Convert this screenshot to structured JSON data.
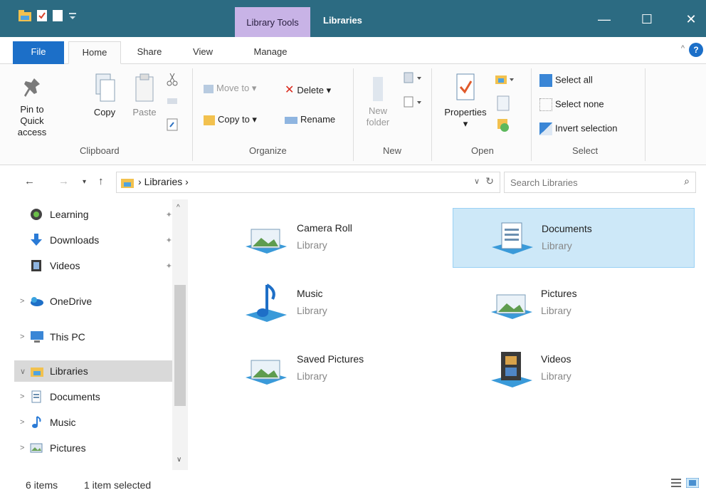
{
  "titlebar": {
    "context_tab": "Library Tools",
    "title": "Libraries",
    "minimize": "—",
    "maximize": "☐",
    "close": "✕",
    "bg_color": "#2c6b82"
  },
  "tabs": {
    "file": "File",
    "home": "Home",
    "share": "Share",
    "view": "View",
    "manage": "Manage",
    "help": "?"
  },
  "ribbon": {
    "clipboard": {
      "pin": "Pin to Quick access",
      "copy": "Copy",
      "paste": "Paste",
      "label": "Clipboard"
    },
    "organize": {
      "move_to": "Move to",
      "copy_to": "Copy to",
      "delete": "Delete",
      "rename": "Rename",
      "label": "Organize"
    },
    "new": {
      "new_folder": "New folder",
      "label": "New"
    },
    "open": {
      "properties": "Properties",
      "label": "Open"
    },
    "select": {
      "select_all": "Select all",
      "select_none": "Select none",
      "invert_selection": "Invert selection",
      "label": "Select"
    }
  },
  "address": {
    "crumb": "Libraries",
    "search_placeholder": "Search Libraries"
  },
  "nav": {
    "items": [
      {
        "label": "Learning",
        "icon": "learning-icon"
      },
      {
        "label": "Downloads",
        "icon": "download-arrow-icon"
      },
      {
        "label": "Videos",
        "icon": "video-icon"
      },
      {
        "label": "OneDrive",
        "icon": "onedrive-icon"
      },
      {
        "label": "This PC",
        "icon": "monitor-icon"
      },
      {
        "label": "Libraries",
        "icon": "library-folder-icon"
      },
      {
        "label": "Documents",
        "icon": "document-icon"
      },
      {
        "label": "Music",
        "icon": "music-note-icon"
      },
      {
        "label": "Pictures",
        "icon": "picture-icon"
      }
    ]
  },
  "libraries": [
    {
      "name": "Camera Roll",
      "type": "Library",
      "icon": "picture-library-icon"
    },
    {
      "name": "Documents",
      "type": "Library",
      "icon": "documents-library-icon"
    },
    {
      "name": "Music",
      "type": "Library",
      "icon": "music-library-icon"
    },
    {
      "name": "Pictures",
      "type": "Library",
      "icon": "picture-library-icon"
    },
    {
      "name": "Saved Pictures",
      "type": "Library",
      "icon": "picture-library-icon"
    },
    {
      "name": "Videos",
      "type": "Library",
      "icon": "video-library-icon"
    }
  ],
  "status": {
    "count": "6 items",
    "selected": "1 item selected"
  },
  "colors": {
    "accent": "#1c6fc8",
    "selection": "#cde8f8",
    "context_tab": "#c8b3e6"
  }
}
